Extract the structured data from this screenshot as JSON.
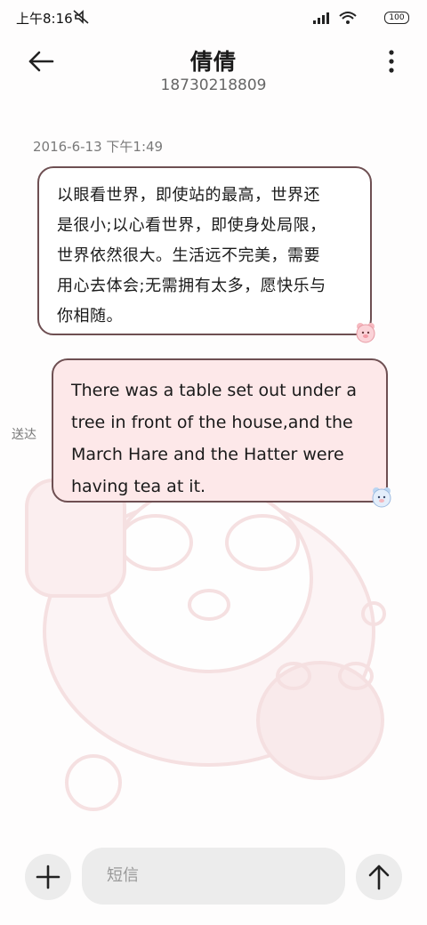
{
  "status_bar": {
    "time": "上午8:16",
    "battery": "100",
    "icons": [
      "mute-icon",
      "signal-icon",
      "wifi-icon",
      "battery-icon"
    ]
  },
  "header": {
    "name": "倩倩",
    "number": "18730218809",
    "back_icon": "arrow-left-icon",
    "more_icon": "more-vertical-icon"
  },
  "conversation": {
    "timestamp": "2016-6-13 下午1:49",
    "messages": [
      {
        "direction": "incoming",
        "lines": [
          "以眼看世界，即使站的最高，世界还",
          "是很小;以心看世界，即使身处局限，",
          "世界依然很大。生活远不完美，需要",
          "用心去体会;无需拥有太多，愿快乐与",
          "你相随。"
        ],
        "sticker": "pink-bear-sticker-icon"
      },
      {
        "direction": "outgoing",
        "status": "送达",
        "lines": [
          "There was a table set out under a",
          "tree in front of the house,and the",
          "March Hare and the Hatter were",
          "having tea at it."
        ],
        "sticker": "blue-bear-sticker-icon"
      }
    ]
  },
  "composer": {
    "placeholder": "短信",
    "add_icon": "plus-icon",
    "send_icon": "arrow-up-icon"
  },
  "colors": {
    "bubble_border": "#6e4f52",
    "outgoing_bubble": "#fde8e9",
    "incoming_bubble": "#ffffff",
    "control_bg": "#ececec"
  }
}
